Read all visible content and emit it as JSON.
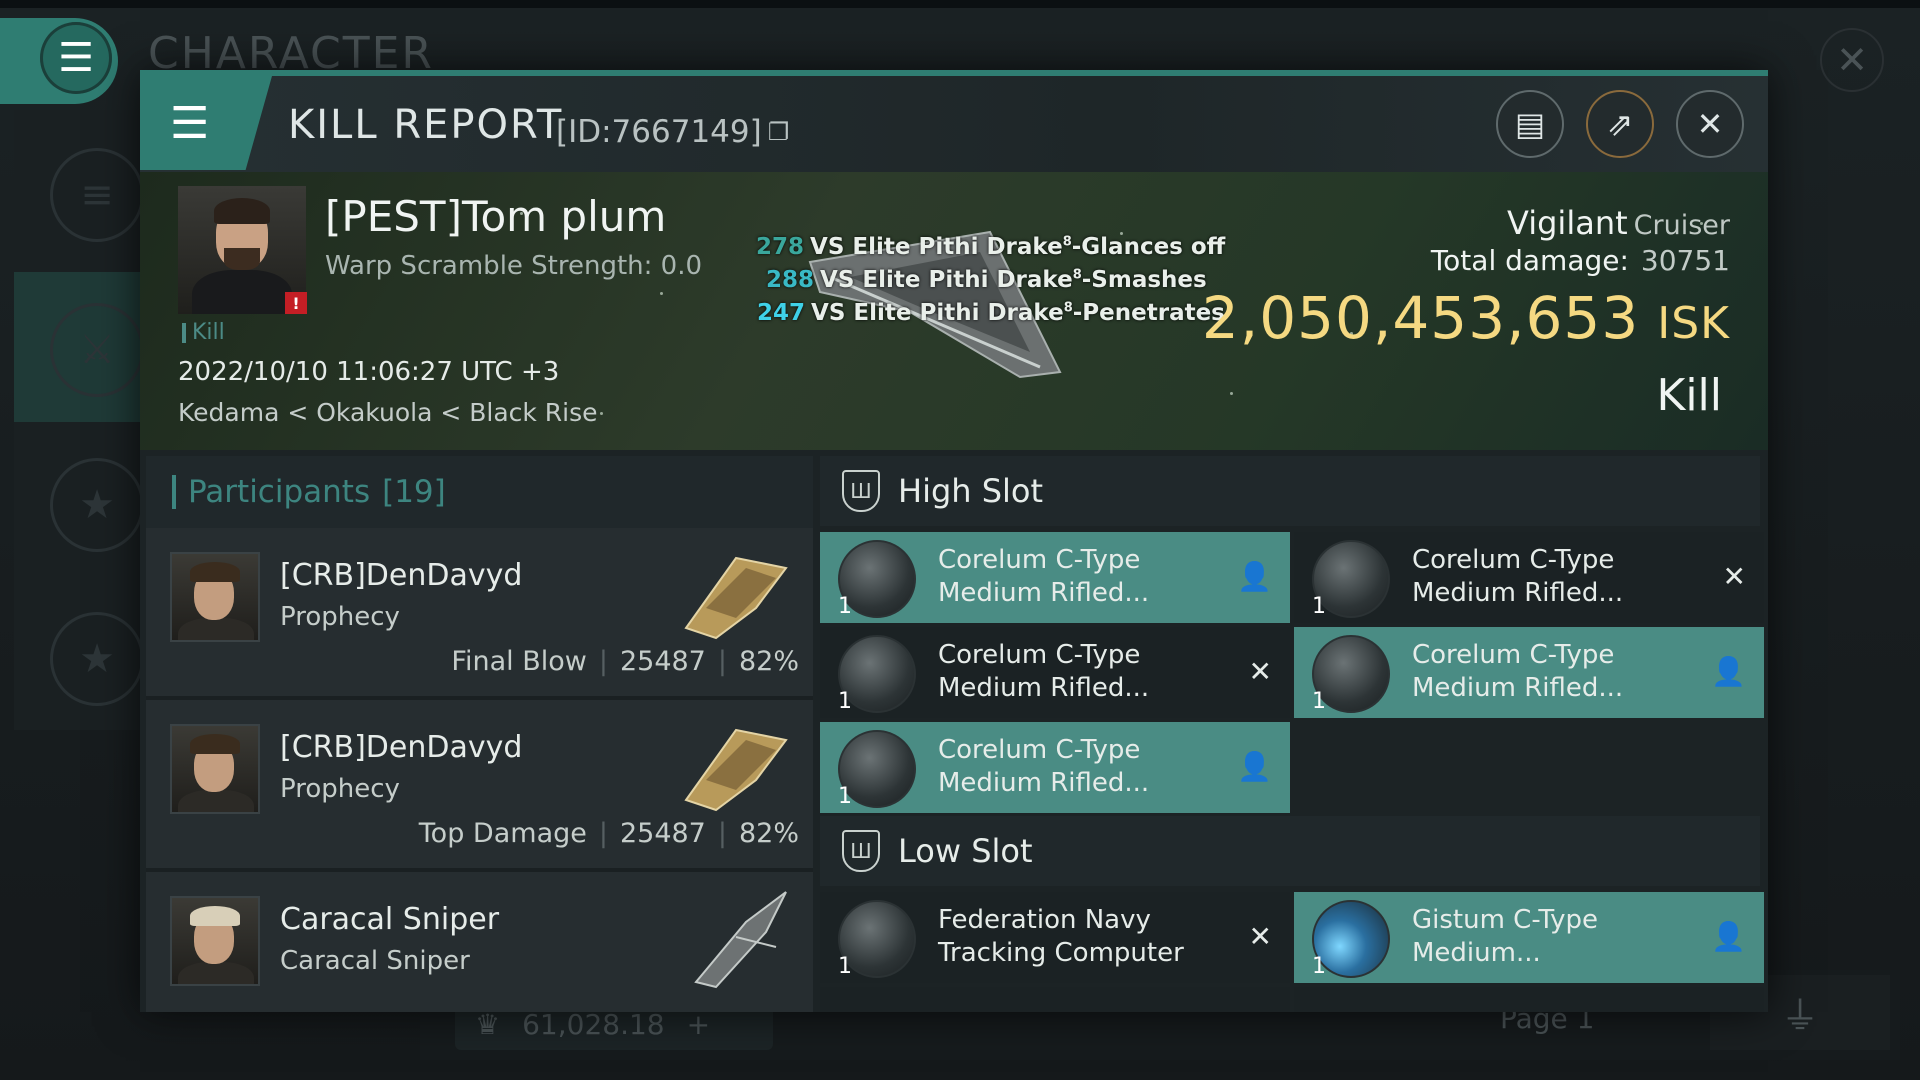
{
  "background": {
    "title": "CHARACTER",
    "menu_icon": "menu-icon",
    "close_icon": "close-icon",
    "balance": "61,028.18",
    "page": "Page 1"
  },
  "report": {
    "title": "KILL REPORT",
    "id_text": "[ID:7667149]",
    "icons": [
      "menu-icon",
      "copy-icon",
      "clipboard-icon",
      "share-icon",
      "close-icon"
    ]
  },
  "victim": {
    "name": "[PEST]Tom plum",
    "warp": "Warp Scramble Strength: 0.0",
    "kill_tag": "Kill",
    "date": "2022/10/10 11:06:27 UTC +3",
    "location": "Kedama < Okakuola < Black Rise",
    "ship": "Vigilant",
    "ship_class": "Cruiser",
    "total_damage_label": "Total damage:",
    "total_damage": "30751",
    "isk_value": "2,050,453,653",
    "isk_unit": "ISK",
    "result": "Kill"
  },
  "damage_log": [
    {
      "value": "278",
      "text": "VS Elite Pithi Drake",
      "sup": "8",
      "suffix": "-Glances off",
      "color": "#3aa79c"
    },
    {
      "value": "288",
      "text": "VS Elite Pithi Drake",
      "sup": "8",
      "suffix": "-Smashes",
      "color": "#39b9c5"
    },
    {
      "value": "247",
      "text": "VS Elite Pithi Drake",
      "sup": "8",
      "suffix": "-Penetrates",
      "color": "#3fd1e8"
    }
  ],
  "participants": {
    "label": "Participants",
    "count": "[19]",
    "rows": [
      {
        "name": "[CRB]DenDavyd",
        "ship": "Prophecy",
        "role": "Final Blow",
        "damage": "25487",
        "percent": "82%"
      },
      {
        "name": "[CRB]DenDavyd",
        "ship": "Prophecy",
        "role": "Top Damage",
        "damage": "25487",
        "percent": "82%"
      },
      {
        "name": "Caracal Sniper",
        "ship": "Caracal Sniper",
        "role": "",
        "damage": "",
        "percent": ""
      }
    ]
  },
  "high_slot": {
    "title": "High Slot",
    "modules": [
      {
        "line1": "Corelum C-Type",
        "line2": "Medium Rifled...",
        "qty": "1",
        "status": "dropped",
        "status_icon": "pilot-icon"
      },
      {
        "line1": "Corelum C-Type",
        "line2": "Medium Rifled...",
        "qty": "1",
        "status": "destroyed",
        "status_icon": "x-icon"
      },
      {
        "line1": "Corelum C-Type",
        "line2": "Medium Rifled...",
        "qty": "1",
        "status": "destroyed",
        "status_icon": "x-icon"
      },
      {
        "line1": "Corelum C-Type",
        "line2": "Medium Rifled...",
        "qty": "1",
        "status": "dropped",
        "status_icon": "pilot-icon"
      },
      {
        "line1": "Corelum C-Type",
        "line2": "Medium Rifled...",
        "qty": "1",
        "status": "dropped",
        "status_icon": "pilot-icon"
      }
    ]
  },
  "low_slot": {
    "title": "Low Slot",
    "modules": [
      {
        "line1": "Federation Navy",
        "line2": "Tracking Computer",
        "qty": "1",
        "status": "destroyed",
        "status_icon": "x-icon"
      },
      {
        "line1": "Gistum C-Type",
        "line2": "Medium...",
        "qty": "1",
        "status": "dropped",
        "status_icon": "pilot-icon"
      }
    ]
  }
}
